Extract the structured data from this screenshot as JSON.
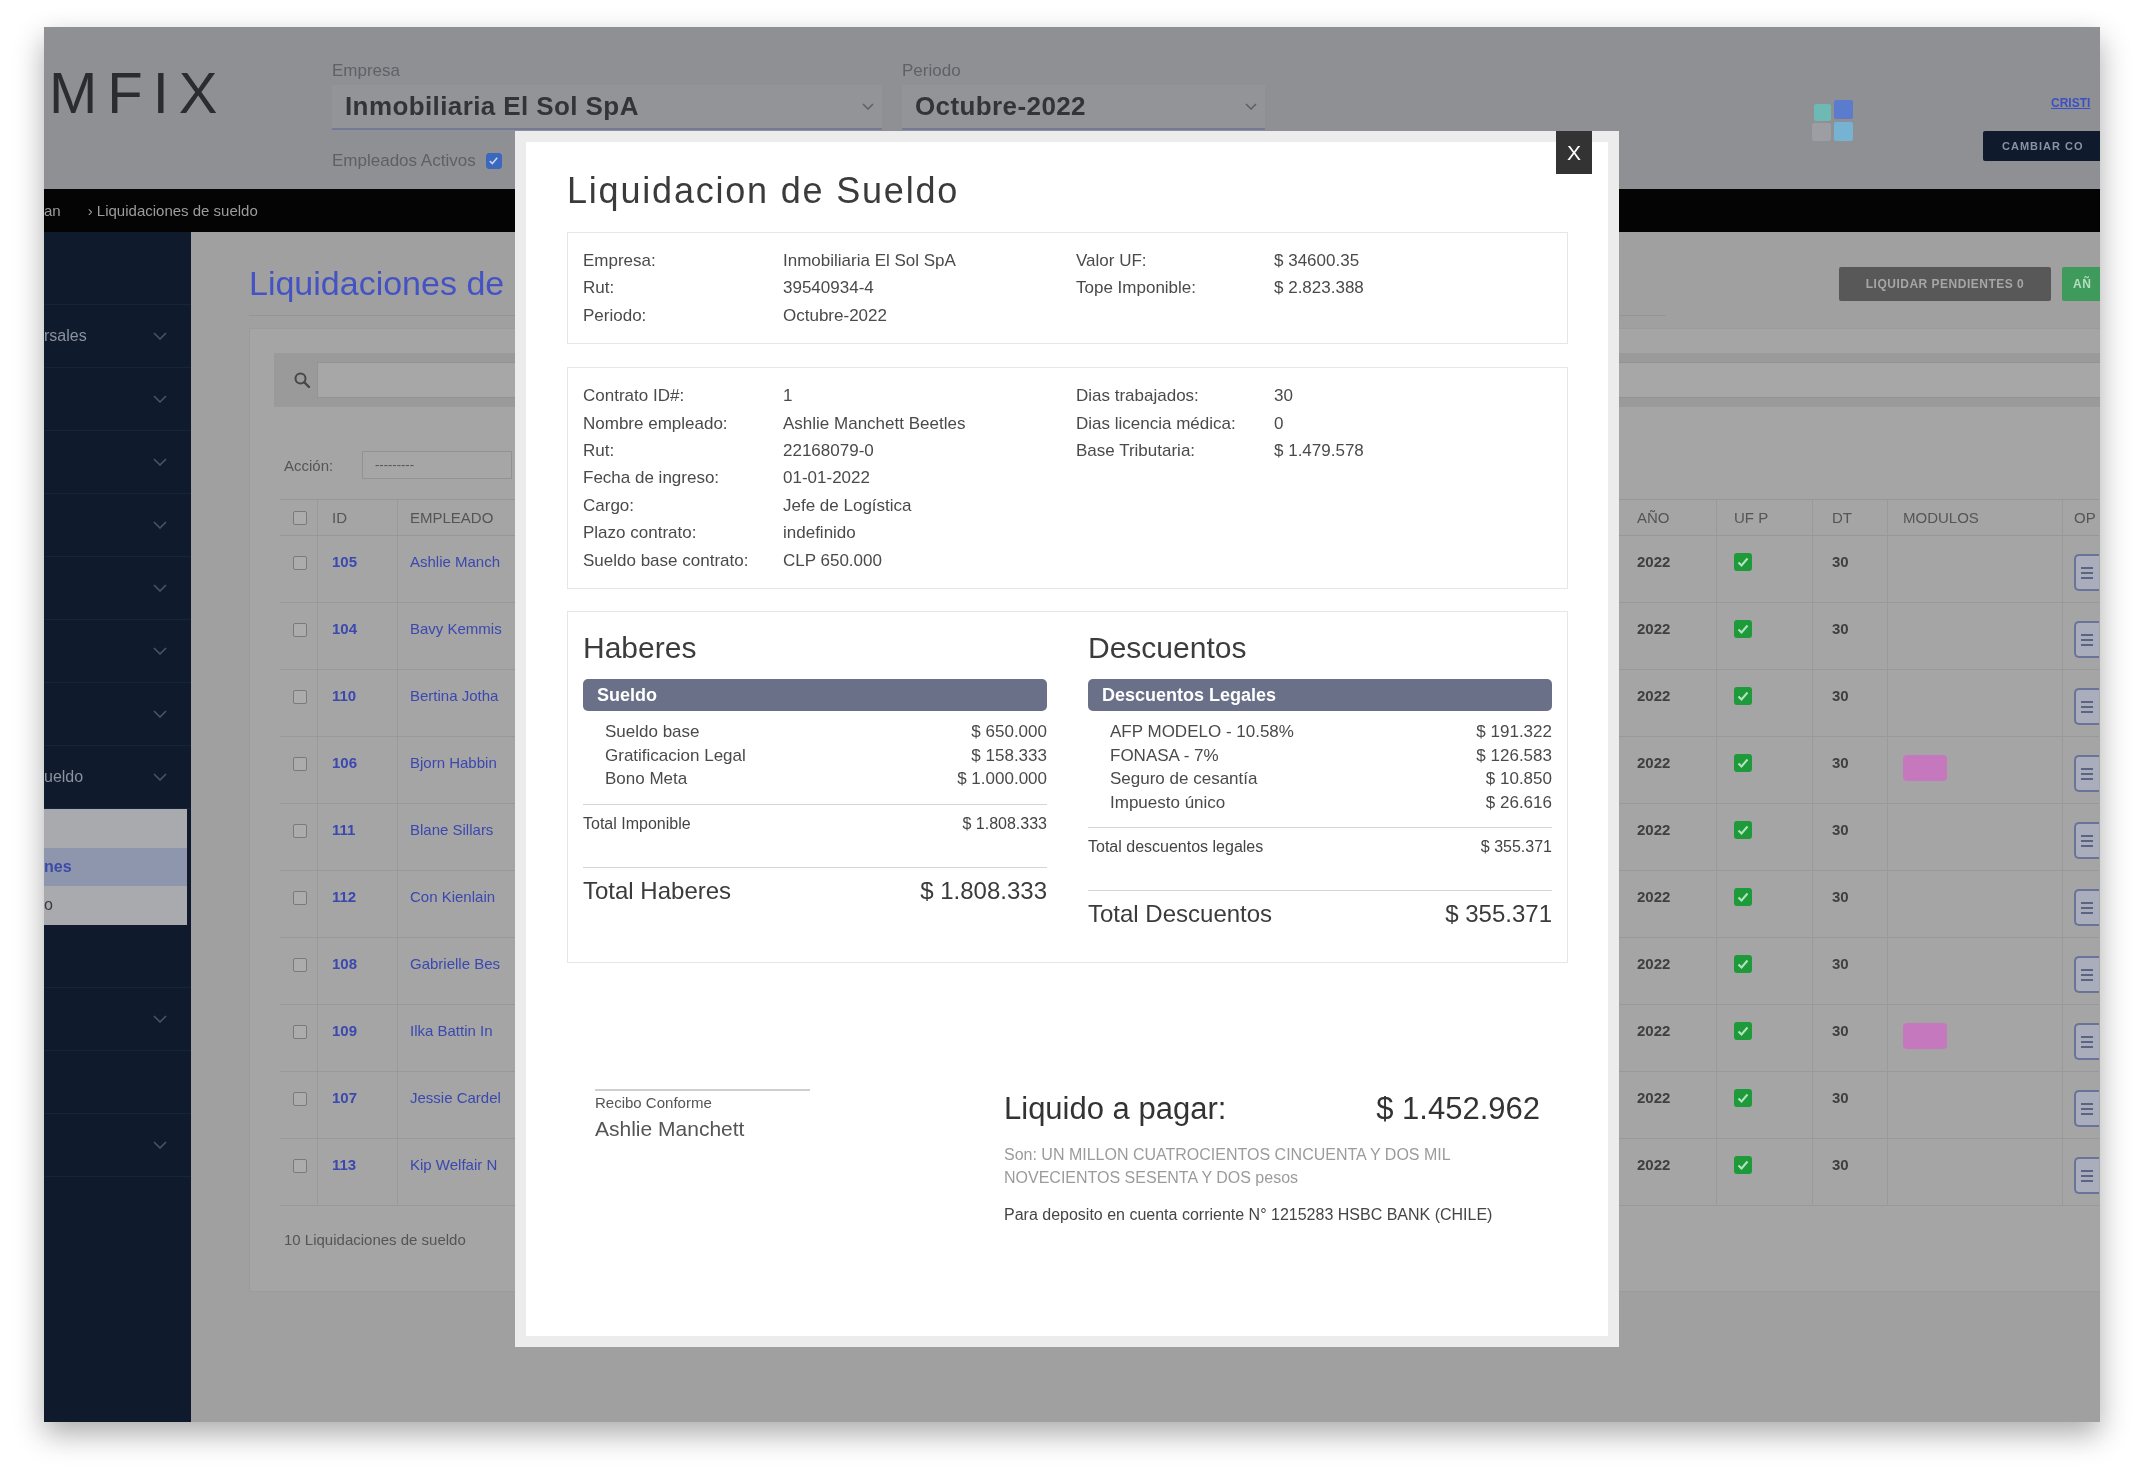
{
  "header": {
    "logo": "MFIX",
    "company": {
      "label": "Empresa",
      "value": "Inmobiliaria El Sol SpA"
    },
    "period": {
      "label": "Periodo",
      "value": "Octubre-2022"
    },
    "active_employees": {
      "label": "Empleados Activos",
      "checked": true
    },
    "user_link": "CRISTI",
    "change_button": "CAMBIAR CO"
  },
  "breadcrumb": [
    "an",
    "› Liquidaciones de sueldo"
  ],
  "sidebar": {
    "items": [
      {
        "expandable": false
      },
      {
        "label": "rsales",
        "expandable": true
      },
      {
        "expandable": true
      },
      {
        "expandable": true
      },
      {
        "expandable": true
      },
      {
        "expandable": true
      },
      {
        "expandable": true
      },
      {
        "expandable": true
      },
      {
        "label": "ueldo",
        "expandable": true,
        "children": [
          {
            "selected": false
          },
          {
            "label": "nes",
            "selected": true
          },
          {
            "label": "o",
            "selected": false
          }
        ]
      },
      {
        "expandable": false
      },
      {
        "expandable": true
      },
      {
        "expandable": false
      },
      {
        "expandable": true
      }
    ]
  },
  "page": {
    "title": "Liquidaciones de",
    "actions": [
      {
        "label": "LIQUIDAR PENDIENTES 0",
        "kind": "secondary"
      },
      {
        "label": "AÑ",
        "kind": "success"
      }
    ],
    "bulk_action": {
      "label": "Acción:",
      "value": "---------"
    }
  },
  "table": {
    "header_checked": false,
    "columns": [
      "ID",
      "EMPLEADO",
      "AÑO",
      "UF P",
      "DT",
      "MODULOS",
      "OP"
    ],
    "rows": [
      {
        "checked": false,
        "id": "105",
        "employee": "Ashlie Manch",
        "year": "2022",
        "uf_p": true,
        "dt": "30",
        "module_tag": false
      },
      {
        "checked": false,
        "id": "104",
        "employee": "Bavy Kemmis",
        "year": "2022",
        "uf_p": true,
        "dt": "30",
        "module_tag": false
      },
      {
        "checked": false,
        "id": "110",
        "employee": "Bertina Jotha",
        "year": "2022",
        "uf_p": true,
        "dt": "30",
        "module_tag": false
      },
      {
        "checked": false,
        "id": "106",
        "employee": "Bjorn Habbin",
        "year": "2022",
        "uf_p": true,
        "dt": "30",
        "module_tag": true
      },
      {
        "checked": false,
        "id": "111",
        "employee": "Blane Sillars",
        "year": "2022",
        "uf_p": true,
        "dt": "30",
        "module_tag": false
      },
      {
        "checked": false,
        "id": "112",
        "employee": "Con Kienlain",
        "year": "2022",
        "uf_p": true,
        "dt": "30",
        "module_tag": false
      },
      {
        "checked": false,
        "id": "108",
        "employee": "Gabrielle Bes",
        "year": "2022",
        "uf_p": true,
        "dt": "30",
        "module_tag": false
      },
      {
        "checked": false,
        "id": "109",
        "employee": "Ilka Battin In",
        "year": "2022",
        "uf_p": true,
        "dt": "30",
        "module_tag": true
      },
      {
        "checked": false,
        "id": "107",
        "employee": "Jessie Cardel",
        "year": "2022",
        "uf_p": true,
        "dt": "30",
        "module_tag": false
      },
      {
        "checked": false,
        "id": "113",
        "employee": "Kip Welfair N",
        "year": "2022",
        "uf_p": true,
        "dt": "30",
        "module_tag": false
      }
    ],
    "footer": "10 Liquidaciones de sueldo"
  },
  "modal": {
    "close": "X",
    "title": "Liquidacion de Sueldo",
    "info_cards": [
      {
        "left": [
          {
            "label": "Empresa:",
            "value": "Inmobiliaria El Sol SpA"
          },
          {
            "label": "Rut:",
            "value": "39540934-4"
          },
          {
            "label": "Periodo:",
            "value": "Octubre-2022"
          }
        ],
        "right": [
          {
            "label": "Valor UF:",
            "value": "$ 34600.35"
          },
          {
            "label": "Tope Imponible:",
            "value": "$ 2.823.388"
          }
        ]
      },
      {
        "left": [
          {
            "label": "Contrato ID#:",
            "value": "1"
          },
          {
            "label": "Nombre empleado:",
            "value": "Ashlie Manchett Beetles"
          },
          {
            "label": "Rut:",
            "value": "22168079-0"
          },
          {
            "label": "Fecha de ingreso:",
            "value": "01-01-2022"
          },
          {
            "label": "Cargo:",
            "value": "Jefe de Logística"
          },
          {
            "label": "Plazo contrato:",
            "value": "indefinido"
          },
          {
            "label": "Sueldo base contrato:",
            "value": "CLP 650.000"
          }
        ],
        "right": [
          {
            "label": "Dias trabajados:",
            "value": "30"
          },
          {
            "label": "Dias licencia médica:",
            "value": "0"
          },
          {
            "label": "Base Tributaria:",
            "value": "$ 1.479.578"
          }
        ]
      }
    ],
    "sections": [
      {
        "title": "Haberes",
        "group": "Sueldo",
        "items": [
          {
            "label": "Sueldo base",
            "amount": "$ 650.000"
          },
          {
            "label": "Gratificacion Legal",
            "amount": "$ 158.333"
          },
          {
            "label": "Bono Meta",
            "amount": "$ 1.000.000"
          }
        ],
        "subtotal": {
          "label": "Total Imponible",
          "amount": "$ 1.808.333"
        },
        "total": {
          "label": "Total Haberes",
          "amount": "$ 1.808.333"
        }
      },
      {
        "title": "Descuentos",
        "group": "Descuentos Legales",
        "items": [
          {
            "label": "AFP MODELO - 10.58%",
            "amount": "$ 191.322"
          },
          {
            "label": "FONASA - 7%",
            "amount": "$ 126.583"
          },
          {
            "label": "Seguro de cesantía",
            "amount": "$ 10.850"
          },
          {
            "label": "Impuesto único",
            "amount": "$ 26.616"
          }
        ],
        "subtotal": {
          "label": "Total descuentos legales",
          "amount": "$ 355.371"
        },
        "total": {
          "label": "Total Descuentos",
          "amount": "$ 355.371"
        }
      }
    ],
    "signature": {
      "caption": "Recibo Conforme",
      "name": "Ashlie Manchett"
    },
    "net_pay": {
      "label": "Liquido a pagar:",
      "amount": "$ 1.452.962",
      "in_words": "Son: UN MILLON CUATROCIENTOS CINCUENTA Y DOS MIL NOVECIENTOS SESENTA Y DOS pesos",
      "deposit": "Para deposito en cuenta corriente N° 1215283 HSBC BANK (CHILE)"
    }
  }
}
